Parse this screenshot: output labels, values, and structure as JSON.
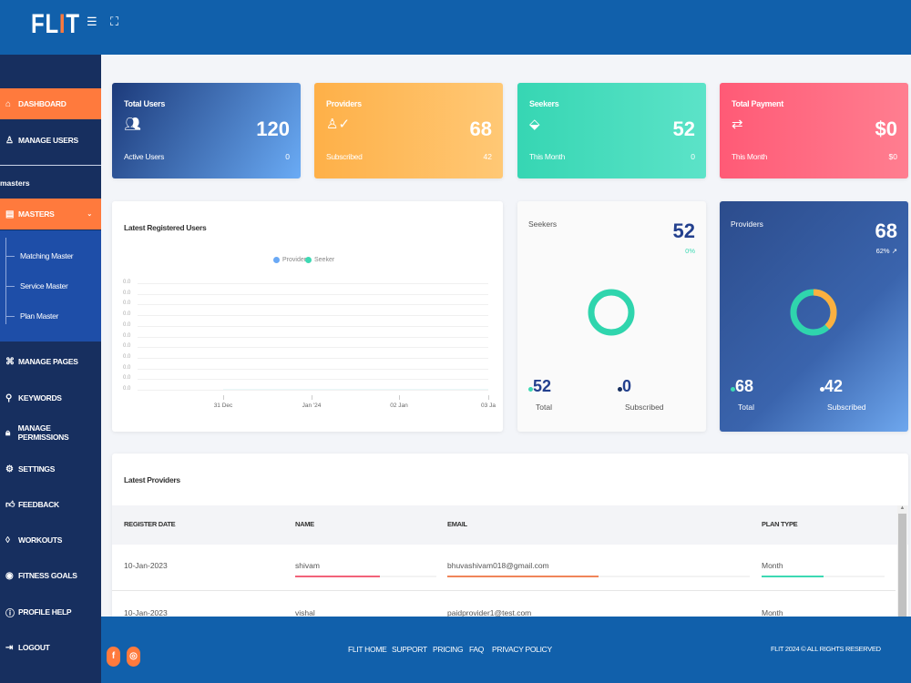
{
  "header": {
    "logo": "FLIT",
    "menu_icon": "menu-icon",
    "fullscreen_icon": "fullscreen-icon"
  },
  "sidebar": {
    "dashboard": "DASHBOARD",
    "manage_users": "MANAGE USERS",
    "section": "masters",
    "masters": "MASTERS",
    "sub": [
      "Matching Master",
      "Service Master",
      "Plan Master"
    ],
    "items": [
      "MANAGE PAGES",
      "KEYWORDS",
      "MANAGE PERMISSIONS",
      "SETTINGS",
      "FEEDBACK",
      "WORKOUTS",
      "FITNESS GOALS",
      "PROFILE HELP",
      "LOGOUT"
    ]
  },
  "stats": [
    {
      "title": "Total Users",
      "value": "120",
      "sub_label": "Active Users",
      "sub_value": "0"
    },
    {
      "title": "Providers",
      "value": "68",
      "sub_label": "Subscribed",
      "sub_value": "42"
    },
    {
      "title": "Seekers",
      "value": "52",
      "sub_label": "This Month",
      "sub_value": "0"
    },
    {
      "title": "Total Payment",
      "value": "$0",
      "sub_label": "This Month",
      "sub_value": "$0"
    }
  ],
  "chart_data": {
    "type": "line",
    "title": "Latest Registered Users",
    "categories": [
      "31 Dec",
      "Jan '24",
      "02 Jan",
      "03 Ja"
    ],
    "y_ticks": [
      "0.0",
      "0.0",
      "0.0",
      "0.0",
      "0.0",
      "0.0",
      "0.0",
      "0.0",
      "0.0",
      "0.0",
      "0.0"
    ],
    "series": [
      {
        "name": "Provider",
        "color": "#6aa9f5",
        "values": [
          0,
          0,
          0,
          0
        ]
      },
      {
        "name": "Seeker",
        "color": "#3dd9b3",
        "values": [
          0,
          0,
          0,
          0
        ]
      }
    ],
    "legend": "top-center",
    "grid": true
  },
  "seekers_card": {
    "title": "Seekers",
    "value": "52",
    "percent": "0%",
    "total": "52",
    "total_label": "Total",
    "subscribed": "0",
    "subscribed_label": "Subscribed"
  },
  "providers_card": {
    "title": "Providers",
    "value": "68",
    "percent": "62%",
    "total": "68",
    "total_label": "Total",
    "subscribed": "42",
    "subscribed_label": "Subscribed"
  },
  "table": {
    "title": "Latest Providers",
    "headers": [
      "REGISTER DATE",
      "NAME",
      "EMAIL",
      "PLAN TYPE"
    ],
    "rows": [
      {
        "date": "10-Jan-2023",
        "name": "shivam",
        "email": "bhuvashivam018@gmail.com",
        "plan": "Month"
      },
      {
        "date": "10-Jan-2023",
        "name": "vishal",
        "email": "paidprovider1@test.com",
        "plan": "Month"
      }
    ]
  },
  "footer": {
    "links": [
      "FLIT HOME",
      "SUPPORT",
      "PRICING",
      "FAQ",
      "PRIVACY POLICY"
    ],
    "copyright": "FLIT 2024 © ALL RIGHTS RESERVED"
  },
  "colors": {
    "primary": "#1160ab",
    "sidebar": "#172f5f",
    "accent": "#ff7a3d",
    "teal": "#3dd9b3",
    "orange": "#fbb040",
    "red": "#ff5f7a"
  }
}
